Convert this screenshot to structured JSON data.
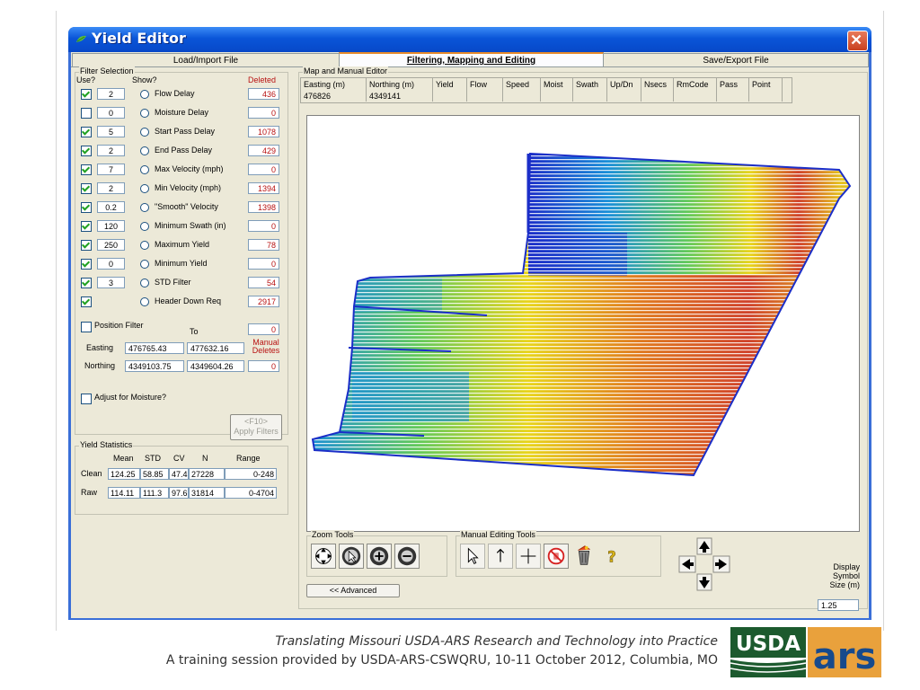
{
  "window": {
    "title": "Yield Editor"
  },
  "tabs": [
    "Load/Import File",
    "Filtering, Mapping and Editing",
    "Save/Export File"
  ],
  "filter_selection": {
    "group_label": "Filter Selection",
    "col_use": "Use?",
    "col_show": "Show?",
    "col_deleted": "Deleted",
    "rows": [
      {
        "checked": true,
        "value": "2",
        "label": "Flow Delay",
        "deleted": "436"
      },
      {
        "checked": false,
        "value": "0",
        "label": "Moisture Delay",
        "deleted": "0"
      },
      {
        "checked": true,
        "value": "5",
        "label": "Start Pass Delay",
        "deleted": "1078"
      },
      {
        "checked": true,
        "value": "2",
        "label": "End Pass Delay",
        "deleted": "429"
      },
      {
        "checked": true,
        "value": "7",
        "label": "Max Velocity (mph)",
        "deleted": "0"
      },
      {
        "checked": true,
        "value": "2",
        "label": "Min Velocity (mph)",
        "deleted": "1394"
      },
      {
        "checked": true,
        "value": "0.2",
        "label": "\"Smooth\" Velocity",
        "deleted": "1398"
      },
      {
        "checked": true,
        "value": "120",
        "label": "Minimum Swath (in)",
        "deleted": "0"
      },
      {
        "checked": true,
        "value": "250",
        "label": "Maximum Yield",
        "deleted": "78"
      },
      {
        "checked": true,
        "value": "0",
        "label": "Minimum Yield",
        "deleted": "0"
      },
      {
        "checked": true,
        "value": "3",
        "label": "STD Filter",
        "deleted": "54"
      },
      {
        "checked": true,
        "value": "",
        "label": "Header Down Req",
        "deleted": "2917"
      }
    ],
    "position_filter": {
      "label": "Position Filter",
      "checked": false,
      "to_label": "To",
      "deleted": "0"
    },
    "easting": {
      "label": "Easting",
      "from": "476765.43",
      "to": "477632.16"
    },
    "northing": {
      "label": "Northing",
      "from": "4349103.75",
      "to": "4349604.26"
    },
    "manual_deletes": {
      "label": "Manual Deletes",
      "value": "0"
    },
    "adjust_moisture": {
      "label": "Adjust for Moisture?",
      "checked": false
    },
    "apply_button": {
      "line1": "<F10>",
      "line2": "Apply Filters"
    }
  },
  "yield_statistics": {
    "group_label": "Yield Statistics",
    "headers": [
      "Mean",
      "STD",
      "CV",
      "N",
      "Range"
    ],
    "rows": [
      {
        "label": "Clean",
        "values": [
          "124.25",
          "58.85",
          "47.4",
          "27228",
          "0-248"
        ]
      },
      {
        "label": "Raw",
        "values": [
          "114.11",
          "111.3",
          "97.6",
          "31814",
          "0-4704"
        ]
      }
    ]
  },
  "map_editor": {
    "group_label": "Map and Manual Editor",
    "columns": [
      "Easting (m)",
      "Northing (m)",
      "Yield",
      "Flow",
      "Speed",
      "Moist",
      "Swath",
      "Up/Dn",
      "Nsecs",
      "RmCode",
      "Pass",
      "Point"
    ],
    "values": [
      "476826",
      "4349141",
      "",
      "",
      "",
      "",
      "",
      "",
      "",
      "",
      "",
      ""
    ]
  },
  "zoom_tools": {
    "label": "Zoom Tools",
    "tools": [
      "pan-icon",
      "zoom-select-icon",
      "zoom-in-icon",
      "zoom-out-icon"
    ]
  },
  "manual_tools": {
    "label": "Manual Editing Tools",
    "tools": [
      "pointer-arrow-icon",
      "up-arrow-icon",
      "crosshair-icon",
      "no-delete-icon",
      "trash-icon",
      "help-icon"
    ],
    "help_glyph": "?"
  },
  "advanced_button": "<< Advanced",
  "display_symbol": {
    "label": "Display Symbol Size (m)",
    "value": "1.25"
  },
  "footer": {
    "line1": "Translating Missouri USDA-ARS Research and Technology into Practice",
    "line2": "A training session provided by USDA-ARS-CSWQRU, 10-11 October 2012, Columbia, MO"
  },
  "logo": {
    "usda": "USDA",
    "ars": "ars"
  }
}
